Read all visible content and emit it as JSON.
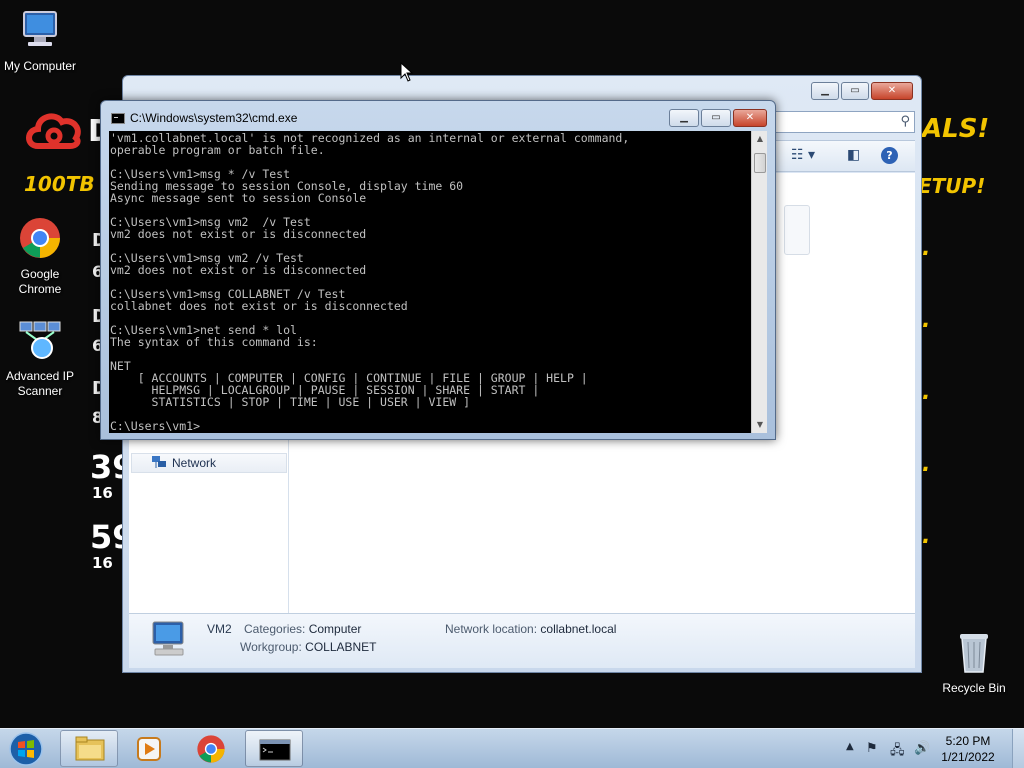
{
  "desktop": {
    "icons": [
      {
        "label": "My Computer"
      },
      {
        "label": "Google Chrome"
      },
      {
        "label": "Advanced IP Scanner"
      },
      {
        "label": "Recycle Bin"
      }
    ],
    "wallpaper": {
      "brand_letter": "D",
      "deals": "ALS!",
      "storage": "100TB",
      "setup": "ETUP!",
      "left_rows": [
        "D",
        "6",
        "D",
        "6",
        "D",
        "8",
        "39",
        "16",
        "59",
        "16"
      ],
      "right_marks": [
        ".",
        ".",
        ".",
        ".",
        "."
      ],
      "accent": "#f2c400"
    }
  },
  "explorer": {
    "nav": {
      "network_label": "Network"
    },
    "details": {
      "name": "VM2",
      "categories_label": "Categories:",
      "categories_value": "Computer",
      "workgroup_label": "Workgroup:",
      "workgroup_value": "COLLABNET",
      "location_label": "Network location:",
      "location_value": "collabnet.local"
    }
  },
  "cmd": {
    "title": "C:\\Windows\\system32\\cmd.exe",
    "output": "'vm1.collabnet.local' is not recognized as an internal or external command,\noperable program or batch file.\n\nC:\\Users\\vm1>msg * /v Test\nSending message to session Console, display time 60\nAsync message sent to session Console\n\nC:\\Users\\vm1>msg vm2  /v Test\nvm2 does not exist or is disconnected\n\nC:\\Users\\vm1>msg vm2 /v Test\nvm2 does not exist or is disconnected\n\nC:\\Users\\vm1>msg COLLABNET /v Test\ncollabnet does not exist or is disconnected\n\nC:\\Users\\vm1>net send * lol\nThe syntax of this command is:\n\nNET\n    [ ACCOUNTS | COMPUTER | CONFIG | CONTINUE | FILE | GROUP | HELP |\n      HELPMSG | LOCALGROUP | PAUSE | SESSION | SHARE | START |\n      STATISTICS | STOP | TIME | USE | USER | VIEW ]\n\nC:\\Users\\vm1>"
  },
  "taskbar": {
    "time": "5:20 PM",
    "date": "1/21/2022"
  }
}
